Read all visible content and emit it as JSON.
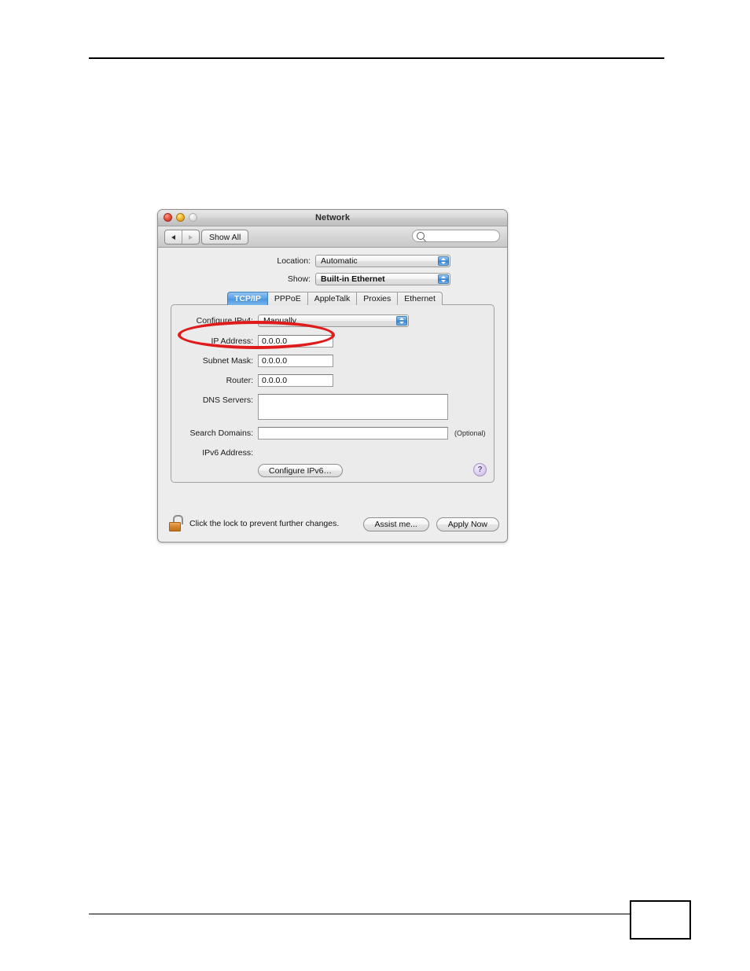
{
  "page": {
    "number_box_text": ""
  },
  "window": {
    "title": "Network",
    "traffic_lights": [
      "close-light",
      "minimize-light",
      "zoom-light"
    ],
    "toolbar": {
      "back_icon": "triangle-left-icon",
      "forward_icon": "triangle-right-icon",
      "show_all_label": "Show All",
      "search_placeholder": "",
      "search_value": "",
      "search_icon": "magnifier-icon"
    },
    "popups": [
      {
        "label": "Location:",
        "value": "Automatic"
      },
      {
        "label": "Show:",
        "value": "Built-in Ethernet"
      }
    ],
    "tabs": [
      {
        "label": "TCP/IP",
        "active": true
      },
      {
        "label": "PPPoE",
        "active": false
      },
      {
        "label": "AppleTalk",
        "active": false
      },
      {
        "label": "Proxies",
        "active": false
      },
      {
        "label": "Ethernet",
        "active": false
      }
    ],
    "form": {
      "configure_ipv4": {
        "label": "Configure IPv4:",
        "value": "Manually"
      },
      "ip_address": {
        "label": "IP Address:",
        "value": "0.0.0.0"
      },
      "subnet_mask": {
        "label": "Subnet Mask:",
        "value": "0.0.0.0"
      },
      "router": {
        "label": "Router:",
        "value": "0.0.0.0"
      },
      "dns_servers": {
        "label": "DNS Servers:",
        "value": ""
      },
      "search_domains": {
        "label": "Search Domains:",
        "value": "",
        "hint": "(Optional)"
      },
      "ipv6_address": {
        "label": "IPv6 Address:",
        "value": ""
      },
      "configure_ipv6_button": "Configure IPv6…",
      "help_button": "?"
    },
    "bottom": {
      "lock_icon": "open-padlock-icon",
      "lock_text": "Click the lock to prevent further changes.",
      "assist_label": "Assist me...",
      "apply_label": "Apply Now"
    }
  },
  "annotation": {
    "shape": "red-ellipse-highlight",
    "color": "#e01b1b",
    "targets": "Configure IPv4 popup menu"
  }
}
